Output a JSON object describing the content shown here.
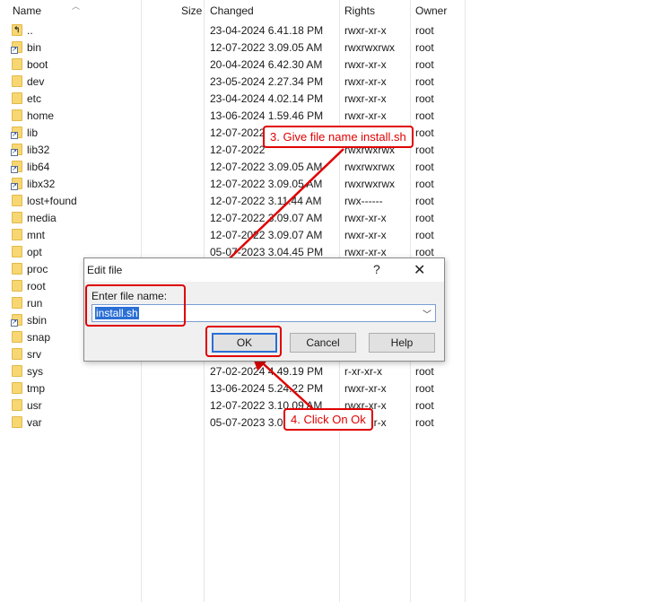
{
  "columns": {
    "name": "Name",
    "size": "Size",
    "changed": "Changed",
    "rights": "Rights",
    "owner": "Owner"
  },
  "files": [
    {
      "name": "..",
      "changed": "23-04-2024 6.41.18 PM",
      "rights": "rwxr-xr-x",
      "owner": "root",
      "icon": "parent-folder-icon"
    },
    {
      "name": "bin",
      "changed": "12-07-2022 3.09.05 AM",
      "rights": "rwxrwxrwx",
      "owner": "root",
      "icon": "folder-link-icon"
    },
    {
      "name": "boot",
      "changed": "20-04-2024 6.42.30 AM",
      "rights": "rwxr-xr-x",
      "owner": "root",
      "icon": "folder-icon"
    },
    {
      "name": "dev",
      "changed": "23-05-2024 2.27.34 PM",
      "rights": "rwxr-xr-x",
      "owner": "root",
      "icon": "folder-icon"
    },
    {
      "name": "etc",
      "changed": "23-04-2024 4.02.14 PM",
      "rights": "rwxr-xr-x",
      "owner": "root",
      "icon": "folder-icon"
    },
    {
      "name": "home",
      "changed": "13-06-2024 1.59.46 PM",
      "rights": "rwxr-xr-x",
      "owner": "root",
      "icon": "folder-icon"
    },
    {
      "name": "lib",
      "changed": "12-07-2022",
      "rights": "",
      "owner": "root",
      "icon": "folder-link-icon"
    },
    {
      "name": "lib32",
      "changed": "12-07-2022",
      "rights": "rwxrwxrwx",
      "owner": "root",
      "icon": "folder-link-icon"
    },
    {
      "name": "lib64",
      "changed": "12-07-2022 3.09.05 AM",
      "rights": "rwxrwxrwx",
      "owner": "root",
      "icon": "folder-link-icon"
    },
    {
      "name": "libx32",
      "changed": "12-07-2022 3.09.05 AM",
      "rights": "rwxrwxrwx",
      "owner": "root",
      "icon": "folder-link-icon"
    },
    {
      "name": "lost+found",
      "changed": "12-07-2022 3.11.44 AM",
      "rights": "rwx------",
      "owner": "root",
      "icon": "folder-icon"
    },
    {
      "name": "media",
      "changed": "12-07-2022 3.09.07 AM",
      "rights": "rwxr-xr-x",
      "owner": "root",
      "icon": "folder-icon"
    },
    {
      "name": "mnt",
      "changed": "12-07-2022 3.09.07 AM",
      "rights": "rwxr-xr-x",
      "owner": "root",
      "icon": "folder-icon"
    },
    {
      "name": "opt",
      "changed": "05-07-2023 3.04.45 PM",
      "rights": "rwxr-xr-x",
      "owner": "root",
      "icon": "folder-icon"
    },
    {
      "name": "proc",
      "changed": "",
      "rights": "",
      "owner": "",
      "icon": "folder-icon"
    },
    {
      "name": "root",
      "changed": "",
      "rights": "",
      "owner": "",
      "icon": "folder-icon"
    },
    {
      "name": "run",
      "changed": "",
      "rights": "",
      "owner": "",
      "icon": "folder-icon"
    },
    {
      "name": "sbin",
      "changed": "",
      "rights": "",
      "owner": "",
      "icon": "folder-link-icon"
    },
    {
      "name": "snap",
      "changed": "",
      "rights": "",
      "owner": "",
      "icon": "folder-icon"
    },
    {
      "name": "srv",
      "changed": "",
      "rights": "",
      "owner": "",
      "icon": "folder-icon"
    },
    {
      "name": "sys",
      "changed": "27-02-2024 4.49.19 PM",
      "rights": "r-xr-xr-x",
      "owner": "root",
      "icon": "folder-icon"
    },
    {
      "name": "tmp",
      "changed": "13-06-2024 5.24.22 PM",
      "rights": "rwxr-xr-x",
      "owner": "root",
      "icon": "folder-icon"
    },
    {
      "name": "usr",
      "changed": "12-07-2022 3.10.09 AM",
      "rights": "rwxr-xr-x",
      "owner": "root",
      "icon": "folder-icon"
    },
    {
      "name": "var",
      "changed": "05-07-2023 3.09",
      "rights": "rwxr-xr-x",
      "owner": "root",
      "icon": "folder-icon"
    }
  ],
  "dialog": {
    "title": "Edit file",
    "help_glyph": "?",
    "close_glyph": "✕",
    "label": "Enter file name:",
    "value": "install.sh",
    "ok": "OK",
    "cancel": "Cancel",
    "help": "Help"
  },
  "annotations": {
    "step3": "3. Give file name install.sh",
    "step4": "4. Click On Ok",
    "color": "#e00000"
  }
}
